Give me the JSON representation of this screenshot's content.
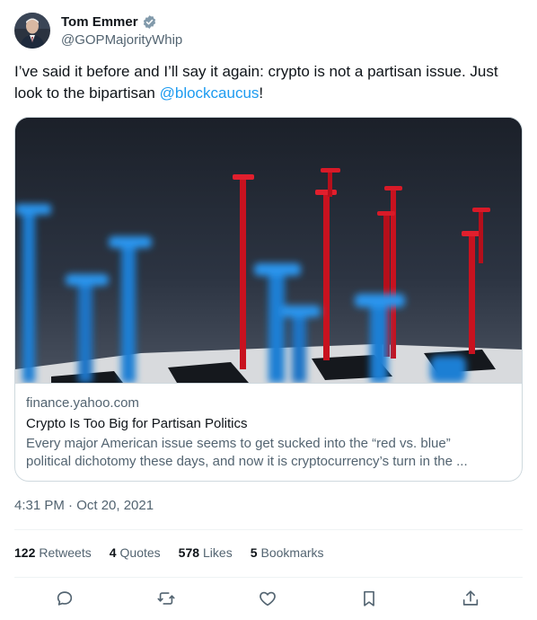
{
  "author": {
    "name": "Tom Emmer",
    "handle": "@GOPMajorityWhip"
  },
  "tweet": {
    "text": "I’ve said it before and I’ll say it again: crypto is not a partisan issue. Just look to the bipartisan ",
    "mention": "@blockcaucus",
    "text_end": "!",
    "timestamp": "4:31 PM · Oct 20, 2021"
  },
  "link_card": {
    "domain": "finance.yahoo.com",
    "title": "Crypto Is Too Big for Partisan Politics",
    "description_line1": "Every major American issue seems to get sucked into the “red vs. blue”",
    "description_line2": "political dichotomy these days, and now it is cryptocurrency’s turn in the ..."
  },
  "stats": {
    "retweets_count": "122",
    "retweets_label": "Retweets",
    "quotes_count": "4",
    "quotes_label": "Quotes",
    "likes_count": "578",
    "likes_label": "Likes",
    "bookmarks_count": "5",
    "bookmarks_label": "Bookmarks"
  },
  "actions": [
    "reply-icon",
    "retweet-icon",
    "like-icon",
    "bookmark-icon",
    "share-icon"
  ],
  "colors": {
    "accent": "#1d9bf0",
    "text": "#0f1419",
    "secondary": "#536471",
    "border": "#cfd9de"
  }
}
